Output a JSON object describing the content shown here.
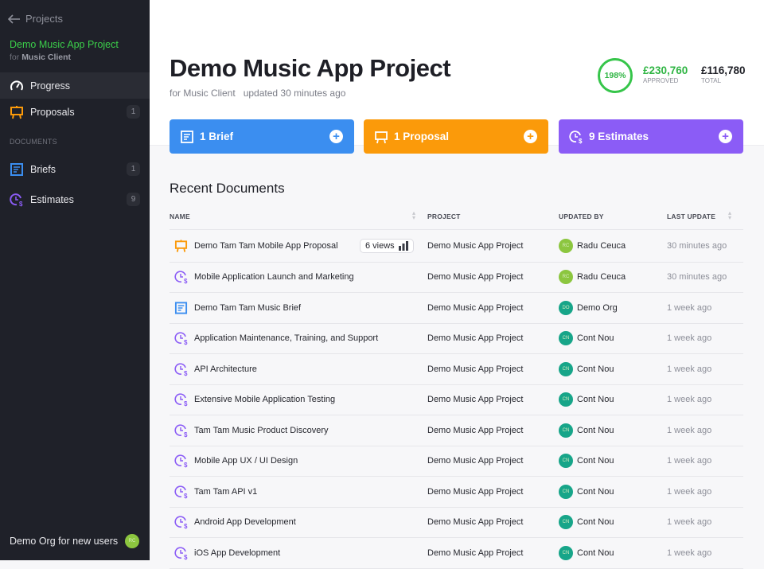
{
  "sidebar": {
    "back": "Projects",
    "project": "Demo Music App Project",
    "client_prefix": "for",
    "client": "Music Client",
    "nav": [
      {
        "label": "Progress",
        "icon": "gauge-icon"
      },
      {
        "label": "Proposals",
        "icon": "easel-icon",
        "count": "1"
      }
    ],
    "section": "DOCUMENTS",
    "docs": [
      {
        "label": "Briefs",
        "icon": "brief-icon",
        "count": "1"
      },
      {
        "label": "Estimates",
        "icon": "estimate-icon",
        "count": "9"
      }
    ],
    "org": "Demo Org for new users",
    "org_avatar": "RC"
  },
  "header": {
    "title": "Demo Music App Project",
    "client": "for Music Client",
    "updated": "updated 30 minutes ago",
    "percent": "198%",
    "approved": "£230,760",
    "approved_label": "APPROVED",
    "total": "£116,780",
    "total_label": "TOTAL"
  },
  "cards": [
    {
      "label": "1 Brief",
      "color": "#3b8ef0"
    },
    {
      "label": "1 Proposal",
      "color": "#fb9a0a"
    },
    {
      "label": "9 Estimates",
      "color": "#8b5cf6"
    }
  ],
  "recent_title": "Recent Documents",
  "columns": [
    "NAME",
    "PROJECT",
    "UPDATED BY",
    "LAST UPDATE"
  ],
  "rows": [
    {
      "type": "proposal",
      "name": "Demo Tam Tam Mobile App Proposal",
      "views": "6 views",
      "project": "Demo Music App Project",
      "user": "Radu Ceuca",
      "initials": "RC",
      "time": "30 minutes ago"
    },
    {
      "type": "estimate",
      "name": "Mobile Application Launch and Marketing",
      "project": "Demo Music App Project",
      "user": "Radu Ceuca",
      "initials": "RC",
      "time": "30 minutes ago"
    },
    {
      "type": "brief",
      "name": "Demo Tam Tam Music Brief",
      "project": "Demo Music App Project",
      "user": "Demo Org",
      "initials": "DO",
      "time": "1 week ago"
    },
    {
      "type": "estimate",
      "name": "Application Maintenance, Training, and Support",
      "project": "Demo Music App Project",
      "user": "Cont Nou",
      "initials": "CN",
      "time": "1 week ago"
    },
    {
      "type": "estimate",
      "name": "API Architecture",
      "project": "Demo Music App Project",
      "user": "Cont Nou",
      "initials": "CN",
      "time": "1 week ago"
    },
    {
      "type": "estimate",
      "name": "Extensive Mobile Application Testing",
      "project": "Demo Music App Project",
      "user": "Cont Nou",
      "initials": "CN",
      "time": "1 week ago"
    },
    {
      "type": "estimate",
      "name": "Tam Tam Music Product Discovery",
      "project": "Demo Music App Project",
      "user": "Cont Nou",
      "initials": "CN",
      "time": "1 week ago"
    },
    {
      "type": "estimate",
      "name": "Mobile App UX / UI Design",
      "project": "Demo Music App Project",
      "user": "Cont Nou",
      "initials": "CN",
      "time": "1 week ago"
    },
    {
      "type": "estimate",
      "name": "Tam Tam API v1",
      "project": "Demo Music App Project",
      "user": "Cont Nou",
      "initials": "CN",
      "time": "1 week ago"
    },
    {
      "type": "estimate",
      "name": "Android App Development",
      "project": "Demo Music App Project",
      "user": "Cont Nou",
      "initials": "CN",
      "time": "1 week ago"
    },
    {
      "type": "estimate",
      "name": "iOS App Development",
      "project": "Demo Music App Project",
      "user": "Cont Nou",
      "initials": "CN",
      "time": "1 week ago"
    }
  ]
}
